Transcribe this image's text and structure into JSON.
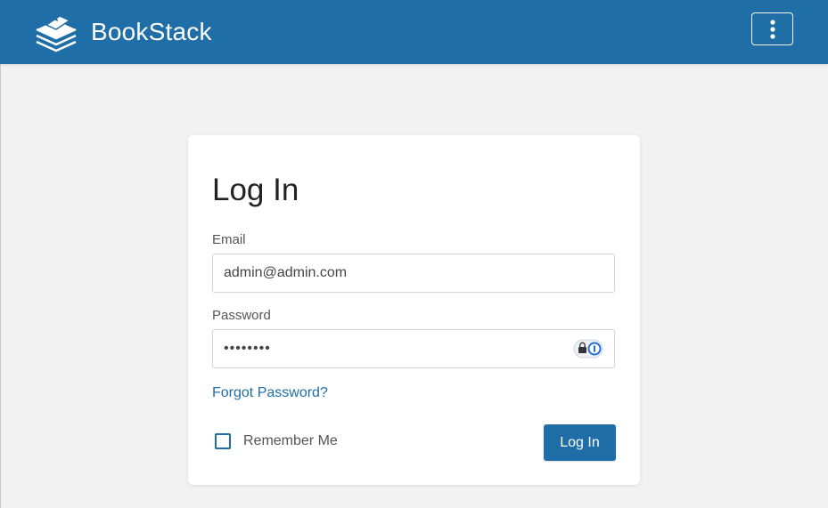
{
  "header": {
    "site_name": "BookStack",
    "logo_icon": "bookstack-logo-icon",
    "menu_icon": "vertical-dots-icon",
    "background_color": "#206ea7"
  },
  "login": {
    "title": "Log In",
    "email_label": "Email",
    "email_value": "admin@admin.com",
    "password_label": "Password",
    "password_value": "••••••••",
    "password_manager_icon": "lock-icon",
    "forgot_password_link": "Forgot Password?",
    "remember_me_label": "Remember Me",
    "remember_me_checked": false,
    "login_button_label": "Log In"
  },
  "colors": {
    "accent": "#206ea7",
    "page_background": "#f2f2f2",
    "card_background": "#ffffff"
  }
}
